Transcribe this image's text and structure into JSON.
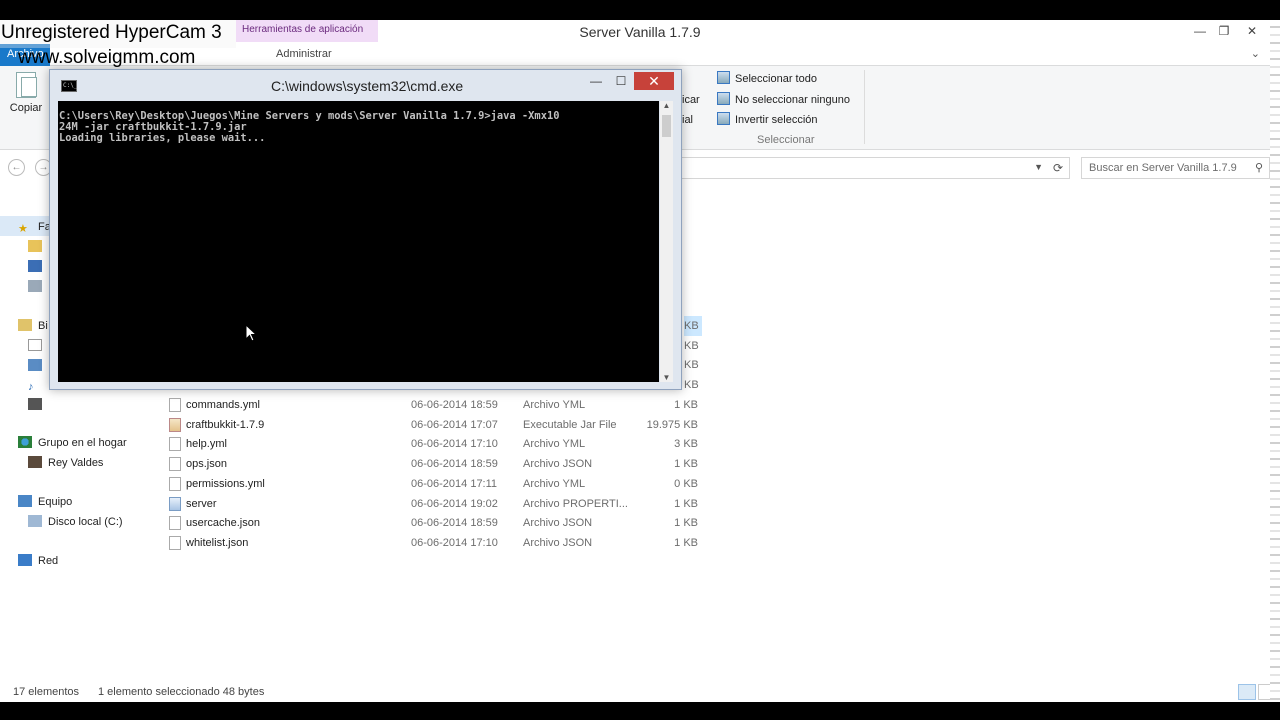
{
  "explorer": {
    "window_title": "Server Vanilla 1.7.9",
    "context_tab": "Herramientas de aplicación",
    "tabs": {
      "archivo": "Archivo",
      "admin": "Administrar"
    },
    "ribbon": {
      "copy_label": "Copiar",
      "select_all": "Seleccionar todo",
      "select_none": "No seleccionar ninguno",
      "invert_selection": "Invertir selección",
      "group_label": "Seleccionar",
      "frag1": "icar",
      "frag2": "ial"
    },
    "search_placeholder": "Buscar en Server Vanilla 1.7.9",
    "nav": {
      "fav_fragment": "Fa",
      "bib_fragment": "Bi",
      "homegroup": "Grupo en el hogar",
      "user": "Rey Valdes",
      "computer": "Equipo",
      "local_disk": "Disco local (C:)",
      "network": "Red"
    },
    "size_fragments": [
      "KB",
      "KB",
      "KB",
      "KB"
    ],
    "files": [
      {
        "name": "commands.yml",
        "date": "06-06-2014 18:59",
        "type": "Archivo YML",
        "size": "1 KB",
        "icon": "file-icon"
      },
      {
        "name": "craftbukkit-1.7.9",
        "date": "06-06-2014 17:07",
        "type": "Executable Jar File",
        "size": "19.975 KB",
        "icon": "jar-file-icon"
      },
      {
        "name": "help.yml",
        "date": "06-06-2014 17:10",
        "type": "Archivo YML",
        "size": "3 KB",
        "icon": "file-icon"
      },
      {
        "name": "ops.json",
        "date": "06-06-2014 18:59",
        "type": "Archivo JSON",
        "size": "1 KB",
        "icon": "file-icon"
      },
      {
        "name": "permissions.yml",
        "date": "06-06-2014 17:11",
        "type": "Archivo YML",
        "size": "0 KB",
        "icon": "file-icon"
      },
      {
        "name": "server",
        "date": "06-06-2014 19:02",
        "type": "Archivo PROPERTI...",
        "size": "1 KB",
        "icon": "properties-file-icon"
      },
      {
        "name": "usercache.json",
        "date": "06-06-2014 18:59",
        "type": "Archivo JSON",
        "size": "1 KB",
        "icon": "file-icon"
      },
      {
        "name": "whitelist.json",
        "date": "06-06-2014 17:10",
        "type": "Archivo JSON",
        "size": "1 KB",
        "icon": "file-icon"
      }
    ],
    "status": {
      "count": "17 elementos",
      "selection": "1 elemento seleccionado  48 bytes"
    }
  },
  "cmd": {
    "title": "C:\\windows\\system32\\cmd.exe",
    "icon_text": "C:\\_",
    "output": "C:\\Users\\Rey\\Desktop\\Juegos\\Mine Servers y mods\\Server Vanilla 1.7.9>java -Xmx10\n24M -jar craftbukkit-1.7.9.jar\nLoading libraries, please wait..."
  },
  "watermark": {
    "line1": "Unregistered HyperCam 3",
    "line2": "www.solveigmm.com"
  }
}
